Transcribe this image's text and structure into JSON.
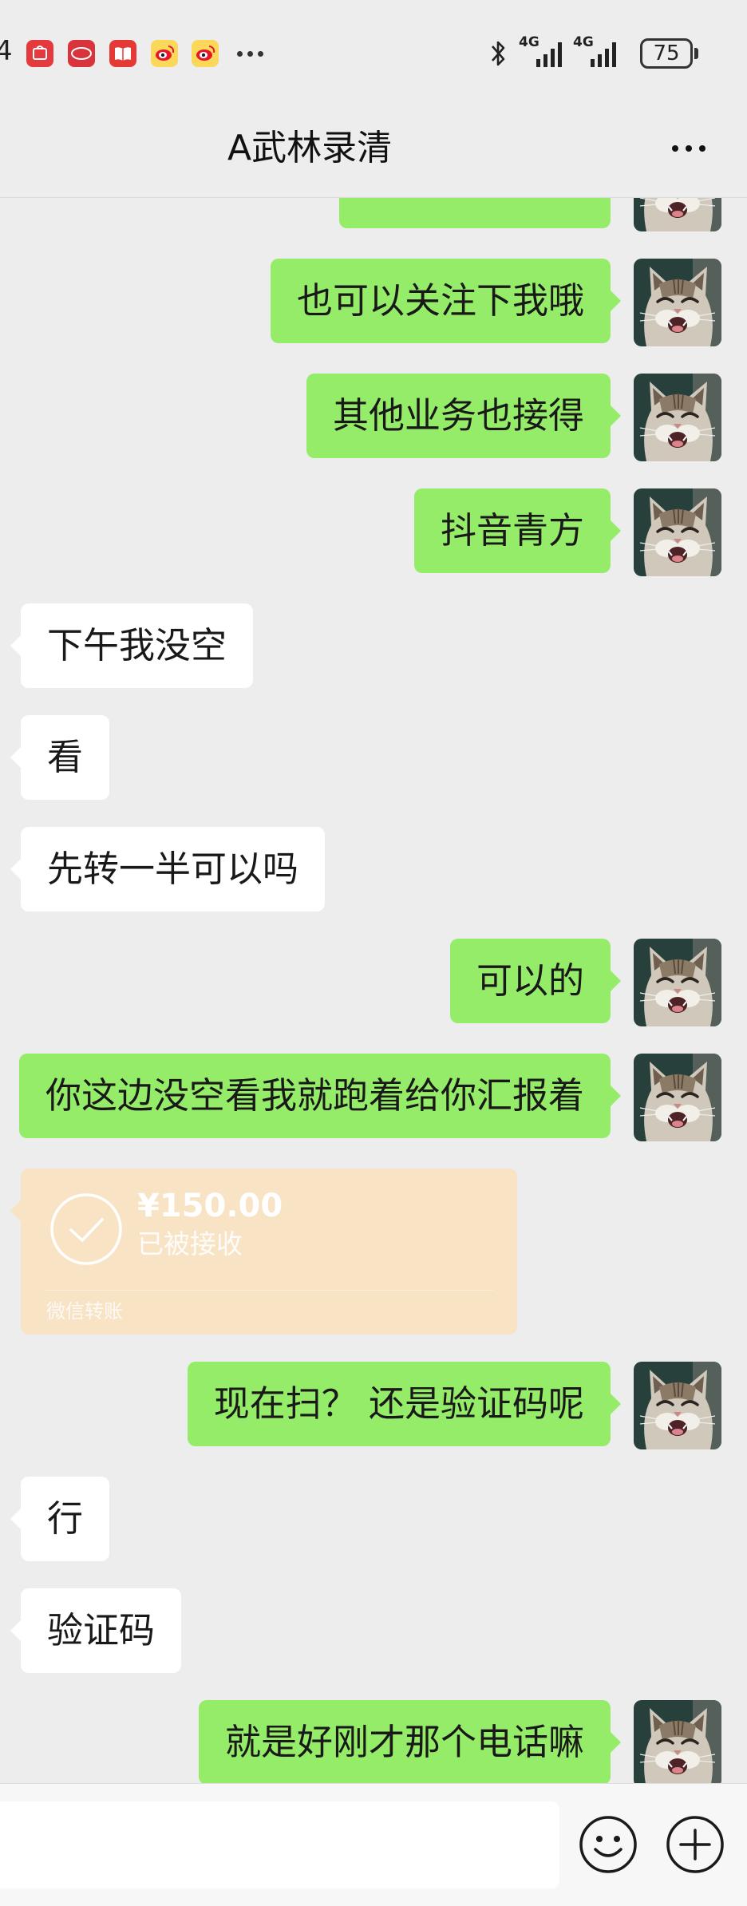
{
  "status_bar": {
    "time_fragment": "4",
    "app_icons": [
      "huawei-appgallery-icon",
      "byd-icon",
      "reader-book-icon",
      "weibo-icon",
      "weibo-icon"
    ],
    "network_1": "4G",
    "network_2": "4G",
    "battery": "75"
  },
  "header": {
    "title": "A武林录清"
  },
  "messages": [
    {
      "sender": "me",
      "type": "text",
      "text": ""
    },
    {
      "sender": "me",
      "type": "text",
      "text": "也可以关注下我哦"
    },
    {
      "sender": "me",
      "type": "text",
      "text": "其他业务也接得"
    },
    {
      "sender": "me",
      "type": "text",
      "text": "抖音青方"
    },
    {
      "sender": "other",
      "type": "text",
      "text": "下午我没空"
    },
    {
      "sender": "other",
      "type": "text",
      "text": "看"
    },
    {
      "sender": "other",
      "type": "text",
      "text": "先转一半可以吗"
    },
    {
      "sender": "me",
      "type": "text",
      "text": "可以的"
    },
    {
      "sender": "me",
      "type": "text",
      "text": "你这边没空看我就跑着给你汇报着"
    },
    {
      "sender": "other",
      "type": "transfer",
      "amount": "¥150.00",
      "status": "已被接收",
      "label": "微信转账"
    },
    {
      "sender": "me",
      "type": "text",
      "text": "现在扫？ 还是验证码呢"
    },
    {
      "sender": "other",
      "type": "text",
      "text": "行"
    },
    {
      "sender": "other",
      "type": "text",
      "text": "验证码"
    },
    {
      "sender": "me",
      "type": "text",
      "text": "就是好刚才那个电话嘛"
    }
  ],
  "input_bar": {
    "icons": [
      "emoji-icon",
      "plus-icon"
    ]
  },
  "colors": {
    "background": "#ededed",
    "sent_bubble": "#95ec69",
    "received_bubble": "#ffffff",
    "transfer_card": "#f8e3c5"
  }
}
